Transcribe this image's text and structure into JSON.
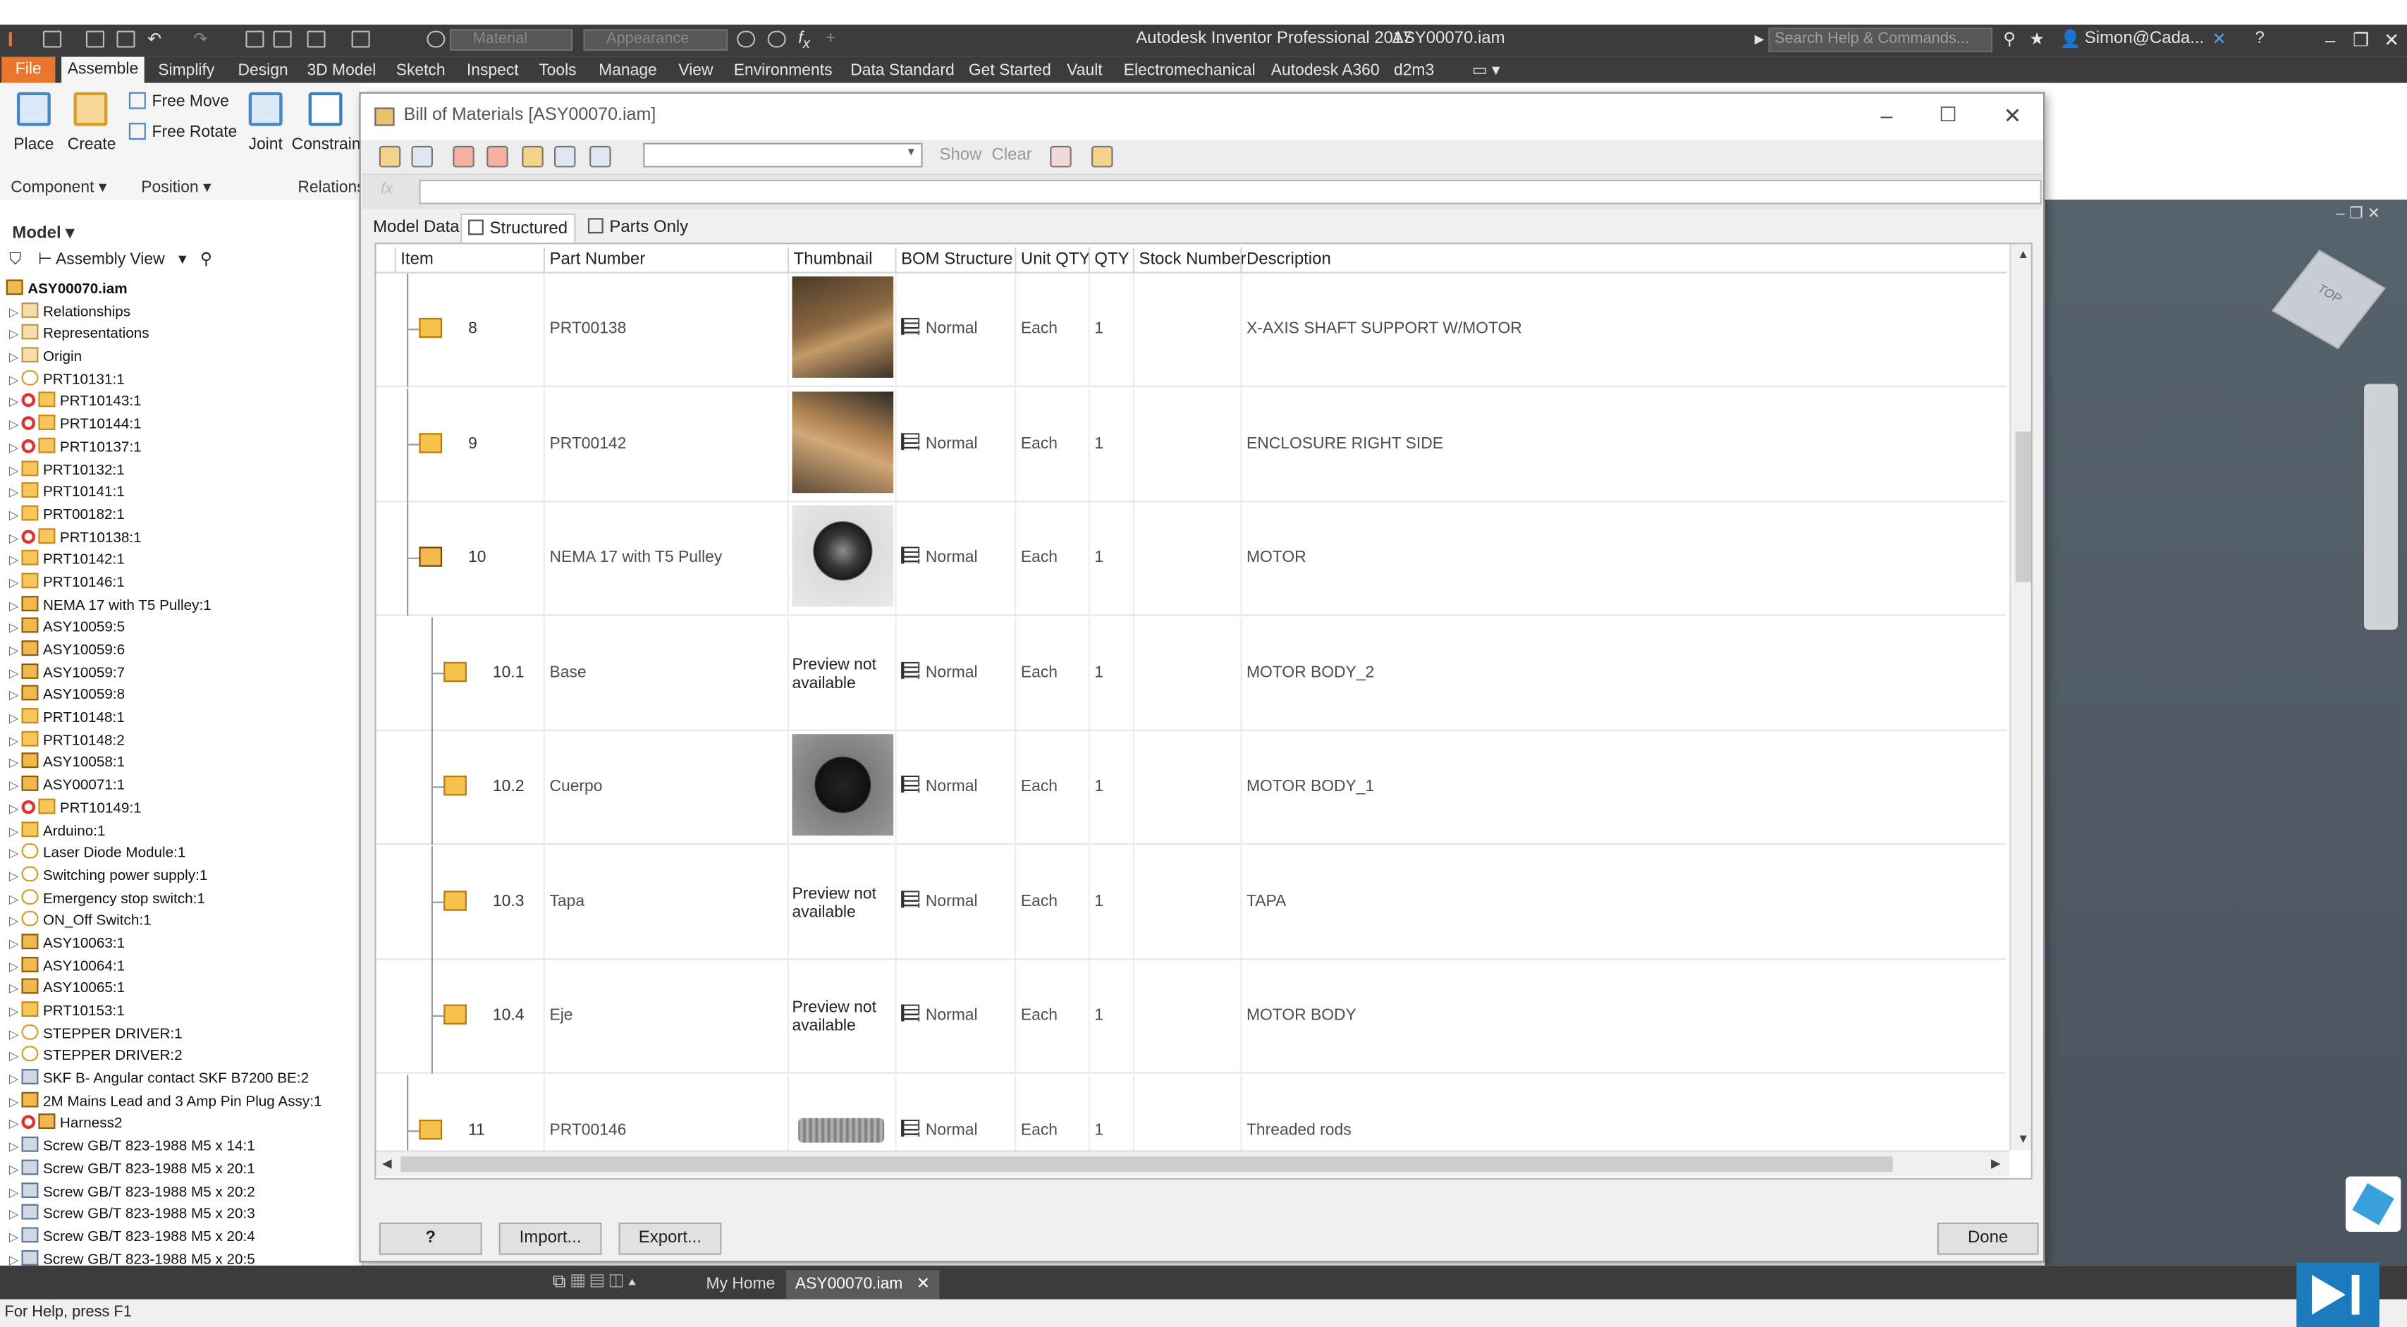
{
  "app": {
    "title": "Autodesk Inventor Professional 2017",
    "document": "ASY00070.iam",
    "search_placeholder": "Search Help & Commands...",
    "user": "Simon@Cada...",
    "material_placeholder": "Material",
    "appearance_placeholder": "Appearance"
  },
  "ribbon_tabs": [
    "File",
    "Assemble",
    "Simplify",
    "Design",
    "3D Model",
    "Sketch",
    "Inspect",
    "Tools",
    "Manage",
    "View",
    "Environments",
    "Data Standard",
    "Get Started",
    "Vault",
    "Electromechanical",
    "Autodesk A360",
    "d2m3"
  ],
  "ribbon": {
    "place": "Place",
    "create": "Create",
    "free_move": "Free Move",
    "free_rotate": "Free Rotate",
    "joint": "Joint",
    "constrain": "Constrain",
    "panel_component": "Component",
    "panel_position": "Position",
    "panel_relations": "Relations"
  },
  "browser": {
    "header": "Model",
    "view": "Assembly View",
    "items": [
      {
        "label": "ASY00070.iam",
        "kind": "root"
      },
      {
        "label": "Relationships",
        "kind": "fold"
      },
      {
        "label": "Representations",
        "kind": "fold"
      },
      {
        "label": "Origin",
        "kind": "fold"
      },
      {
        "label": "PRT10131:1",
        "kind": "wire"
      },
      {
        "label": "PRT10143:1",
        "kind": "part",
        "rel": true
      },
      {
        "label": "PRT10144:1",
        "kind": "part",
        "rel": true
      },
      {
        "label": "PRT10137:1",
        "kind": "part",
        "rel": true
      },
      {
        "label": "PRT10132:1",
        "kind": "part"
      },
      {
        "label": "PRT10141:1",
        "kind": "part"
      },
      {
        "label": "PRT00182:1",
        "kind": "part"
      },
      {
        "label": "PRT10138:1",
        "kind": "part",
        "rel": true
      },
      {
        "label": "PRT10142:1",
        "kind": "part"
      },
      {
        "label": "PRT10146:1",
        "kind": "part"
      },
      {
        "label": "NEMA 17 with T5 Pulley:1",
        "kind": "asm"
      },
      {
        "label": "ASY10059:5",
        "kind": "asm"
      },
      {
        "label": "ASY10059:6",
        "kind": "asm"
      },
      {
        "label": "ASY10059:7",
        "kind": "asm"
      },
      {
        "label": "ASY10059:8",
        "kind": "asm"
      },
      {
        "label": "PRT10148:1",
        "kind": "part"
      },
      {
        "label": "PRT10148:2",
        "kind": "part"
      },
      {
        "label": "ASY10058:1",
        "kind": "asm"
      },
      {
        "label": "ASY00071:1",
        "kind": "asm"
      },
      {
        "label": "PRT10149:1",
        "kind": "part",
        "rel": true
      },
      {
        "label": "Arduino:1",
        "kind": "part"
      },
      {
        "label": "Laser Diode Module:1",
        "kind": "wire"
      },
      {
        "label": "Switching power supply:1",
        "kind": "wire"
      },
      {
        "label": "Emergency stop switch:1",
        "kind": "wire"
      },
      {
        "label": "ON_Off Switch:1",
        "kind": "wire"
      },
      {
        "label": "ASY10063:1",
        "kind": "asm"
      },
      {
        "label": "ASY10064:1",
        "kind": "asm"
      },
      {
        "label": "ASY10065:1",
        "kind": "asm"
      },
      {
        "label": "PRT10153:1",
        "kind": "part"
      },
      {
        "label": "STEPPER DRIVER:1",
        "kind": "wire"
      },
      {
        "label": "STEPPER DRIVER:2",
        "kind": "wire"
      },
      {
        "label": "SKF B- Angular contact SKF B7200 BE:2",
        "kind": "scr"
      },
      {
        "label": "2M Mains Lead and 3 Amp Pin Plug Assy:1",
        "kind": "asm"
      },
      {
        "label": "Harness2",
        "kind": "asm",
        "rel": true
      },
      {
        "label": "Screw GB/T 823-1988 M5 x 14:1",
        "kind": "scr"
      },
      {
        "label": "Screw GB/T 823-1988 M5 x 20:1",
        "kind": "scr"
      },
      {
        "label": "Screw GB/T 823-1988 M5 x 20:2",
        "kind": "scr"
      },
      {
        "label": "Screw GB/T 823-1988 M5 x 20:3",
        "kind": "scr"
      },
      {
        "label": "Screw GB/T 823-1988 M5 x 20:4",
        "kind": "scr"
      },
      {
        "label": "Screw GB/T 823-1988 M5 x 20:5",
        "kind": "scr"
      }
    ]
  },
  "bom": {
    "title": "Bill of Materials [ASY00070.iam]",
    "toolbar": {
      "show": "Show",
      "clear": "Clear"
    },
    "tabs": [
      "Model Data",
      "Structured",
      "Parts Only"
    ],
    "columns": [
      "Item",
      "Part Number",
      "Thumbnail",
      "BOM Structure",
      "Unit QTY",
      "QTY",
      "Stock Number",
      "Description"
    ],
    "rows": [
      {
        "item": "8",
        "part": "PRT00138",
        "thumb": "wood1",
        "bom": "Normal",
        "unit": "Each",
        "qty": "1",
        "stock": "",
        "desc": "X-AXIS SHAFT SUPPORT W/MOTOR",
        "level": 0,
        "asm": false
      },
      {
        "item": "9",
        "part": "PRT00142",
        "thumb": "wood2",
        "bom": "Normal",
        "unit": "Each",
        "qty": "1",
        "stock": "",
        "desc": "ENCLOSURE RIGHT SIDE",
        "level": 0,
        "asm": false
      },
      {
        "item": "10",
        "part": "NEMA 17 with T5 Pulley",
        "thumb": "motor",
        "bom": "Normal",
        "unit": "Each",
        "qty": "1",
        "stock": "",
        "desc": "MOTOR",
        "level": 0,
        "asm": true
      },
      {
        "item": "10.1",
        "part": "Base",
        "thumb": "none",
        "bom": "Normal",
        "unit": "Each",
        "qty": "1",
        "stock": "",
        "desc": "MOTOR BODY_2",
        "level": 1,
        "asm": false
      },
      {
        "item": "10.2",
        "part": "Cuerpo",
        "thumb": "oct",
        "bom": "Normal",
        "unit": "Each",
        "qty": "1",
        "stock": "",
        "desc": "MOTOR BODY_1",
        "level": 1,
        "asm": false
      },
      {
        "item": "10.3",
        "part": "Tapa",
        "thumb": "none",
        "bom": "Normal",
        "unit": "Each",
        "qty": "1",
        "stock": "",
        "desc": "TAPA",
        "level": 1,
        "asm": false
      },
      {
        "item": "10.4",
        "part": "Eje",
        "thumb": "none",
        "bom": "Normal",
        "unit": "Each",
        "qty": "1",
        "stock": "",
        "desc": "MOTOR BODY",
        "level": 1,
        "asm": false
      },
      {
        "item": "11",
        "part": "PRT00146",
        "thumb": "rod",
        "bom": "Normal",
        "unit": "Each",
        "qty": "1",
        "stock": "",
        "desc": "Threaded rods",
        "level": 0,
        "asm": false
      }
    ],
    "preview_na": "Preview not available",
    "buttons": {
      "help": "?",
      "import": "Import...",
      "export": "Export...",
      "done": "Done"
    }
  },
  "doc_tabs": {
    "home": "My Home",
    "active": "ASY00070.iam"
  },
  "status": "For Help, press F1",
  "colors": {
    "accent": "#e9762b",
    "chrome": "#3c3c3c",
    "brand_blue": "#1b7bbd"
  }
}
